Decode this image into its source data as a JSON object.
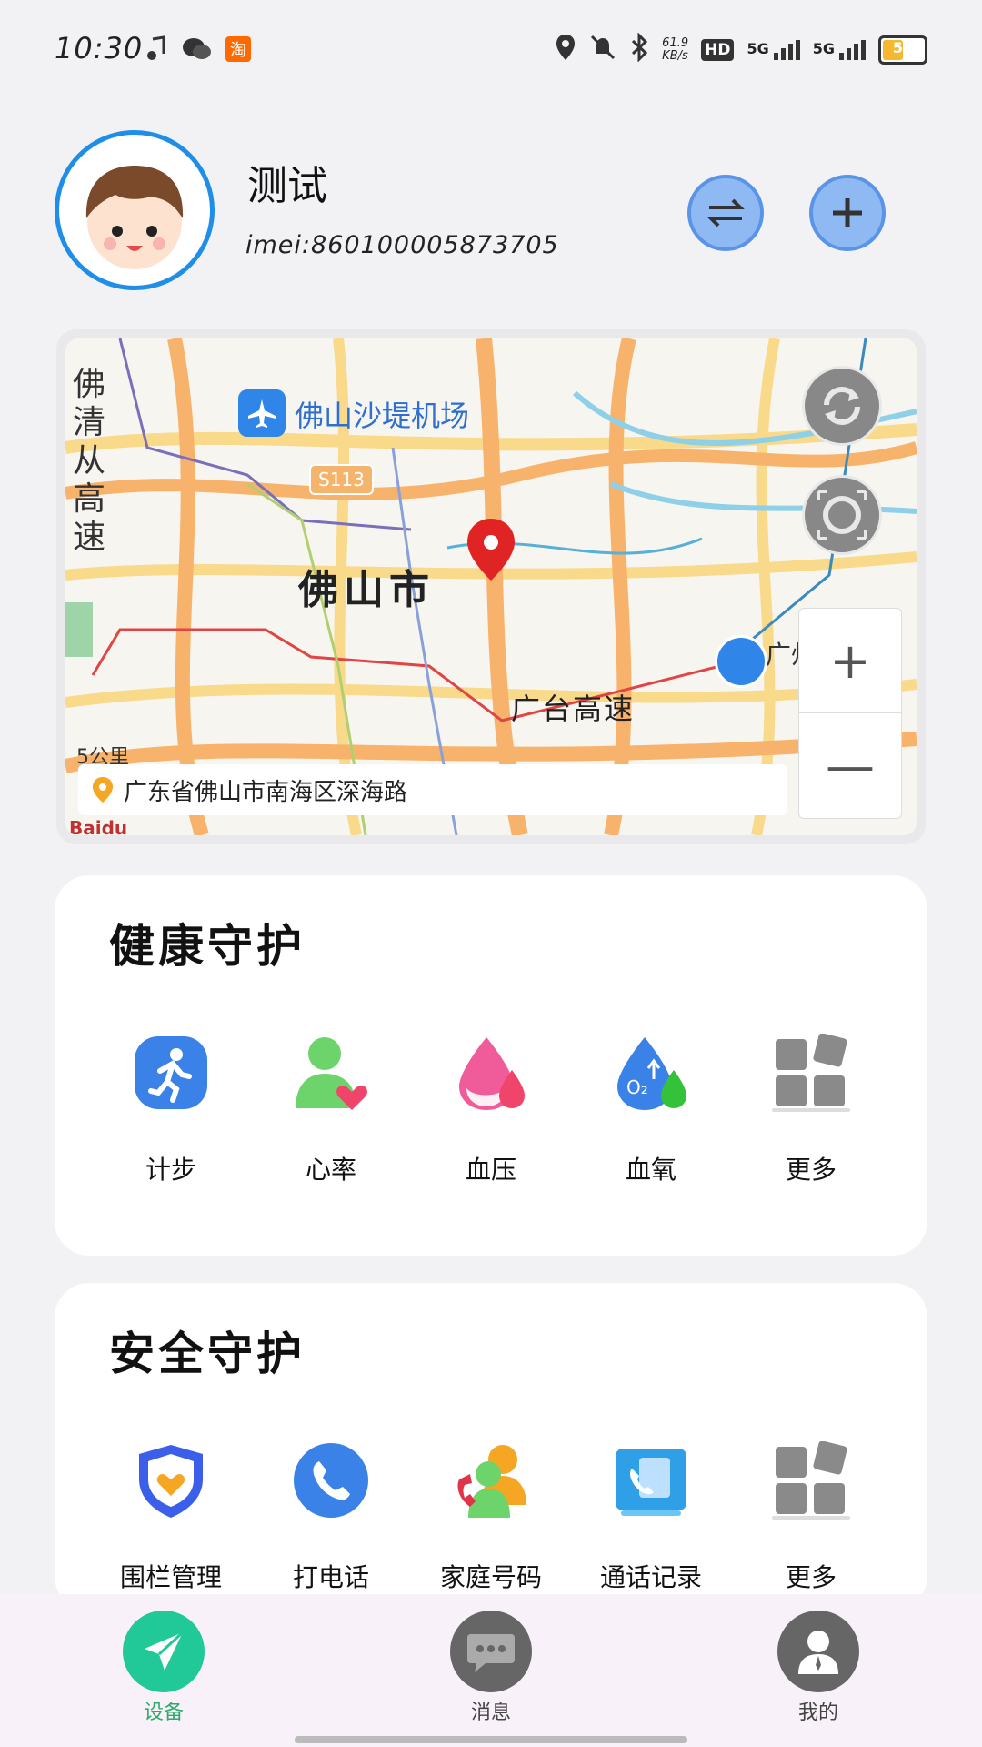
{
  "status_bar": {
    "time": "10:30",
    "net_speed": "61.9\nKB/s",
    "hd_label": "HD",
    "sim1_label": "5G",
    "sim2_label": "5G",
    "battery_text": "55",
    "battery_level": 0.55,
    "taobao_label": "淘"
  },
  "profile": {
    "name": "测试",
    "imei": "imei:860100005873705"
  },
  "map": {
    "address": "广东省佛山市南海区深海路",
    "airport_label": "佛山沙堤机场",
    "city_label": "佛山市",
    "highway_label": "广台高速",
    "road_label": "S113",
    "vertical_label": "佛清从高速",
    "east_label": "广州南",
    "scale_label": "5公里",
    "zoom_in": "+",
    "zoom_out": "—",
    "logo": "Baidu"
  },
  "health": {
    "title": "健康守护",
    "items": [
      {
        "label": "计步",
        "icon": "running-person-icon"
      },
      {
        "label": "心率",
        "icon": "heart-rate-icon"
      },
      {
        "label": "血压",
        "icon": "blood-pressure-icon"
      },
      {
        "label": "血氧",
        "icon": "blood-oxygen-icon"
      },
      {
        "label": "更多",
        "icon": "more-grid-icon"
      }
    ]
  },
  "safety": {
    "title": "安全守护",
    "items": [
      {
        "label": "围栏管理",
        "icon": "fence-shield-icon"
      },
      {
        "label": "打电话",
        "icon": "phone-icon"
      },
      {
        "label": "家庭号码",
        "icon": "family-contacts-icon"
      },
      {
        "label": "通话记录",
        "icon": "call-log-icon"
      },
      {
        "label": "更多",
        "icon": "more-grid-icon"
      }
    ]
  },
  "nav": {
    "device": "设备",
    "message": "消息",
    "mine": "我的"
  },
  "colors": {
    "accent_blue": "#1f8ee8",
    "nav_active": "#20c997",
    "background": "#f2f2f4"
  }
}
